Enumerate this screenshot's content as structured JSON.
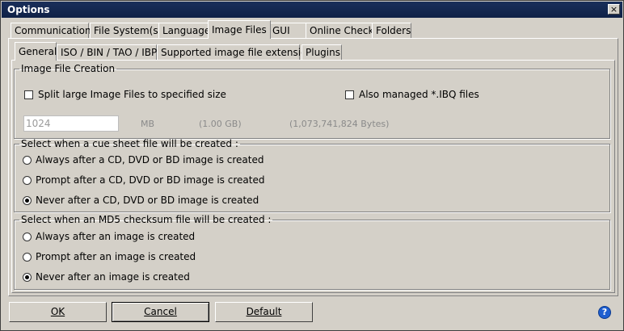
{
  "window": {
    "title": "Options",
    "close_glyph": "×"
  },
  "top_tabs": [
    "Communication",
    "File System(s)",
    "Language",
    "Image Files",
    "GUI",
    "Online Check",
    "Folders"
  ],
  "sub_tabs": [
    "General",
    "ISO / BIN / TAO / IBP",
    "Supported image file extensions",
    "Plugins"
  ],
  "image_file_creation": {
    "legend": "Image File Creation",
    "split_label": "Split large Image Files to specified size",
    "split_checked": false,
    "ibq_label": "Also managed *.IBQ files",
    "ibq_checked": false,
    "size_value": "1024",
    "size_unit": "MB",
    "size_gb": "(1.00 GB)",
    "size_bytes": "(1,073,741,824 Bytes)"
  },
  "cue_sheet": {
    "legend": "Select when a cue sheet file will be created :",
    "options": [
      "Always after a CD, DVD or BD image is created",
      "Prompt after a CD, DVD or BD image is created",
      "Never after a CD, DVD or BD image is created"
    ],
    "selected_index": 2
  },
  "md5": {
    "legend": "Select when an MD5 checksum file will be created :",
    "options": [
      "Always after an image is created",
      "Prompt after an image is created",
      "Never after an image is created"
    ],
    "selected_index": 2
  },
  "buttons": {
    "ok": "OK",
    "cancel": "Cancel",
    "default": "Default"
  },
  "help_glyph": "?",
  "icons": {
    "close": "close-icon",
    "help": "help-icon"
  }
}
